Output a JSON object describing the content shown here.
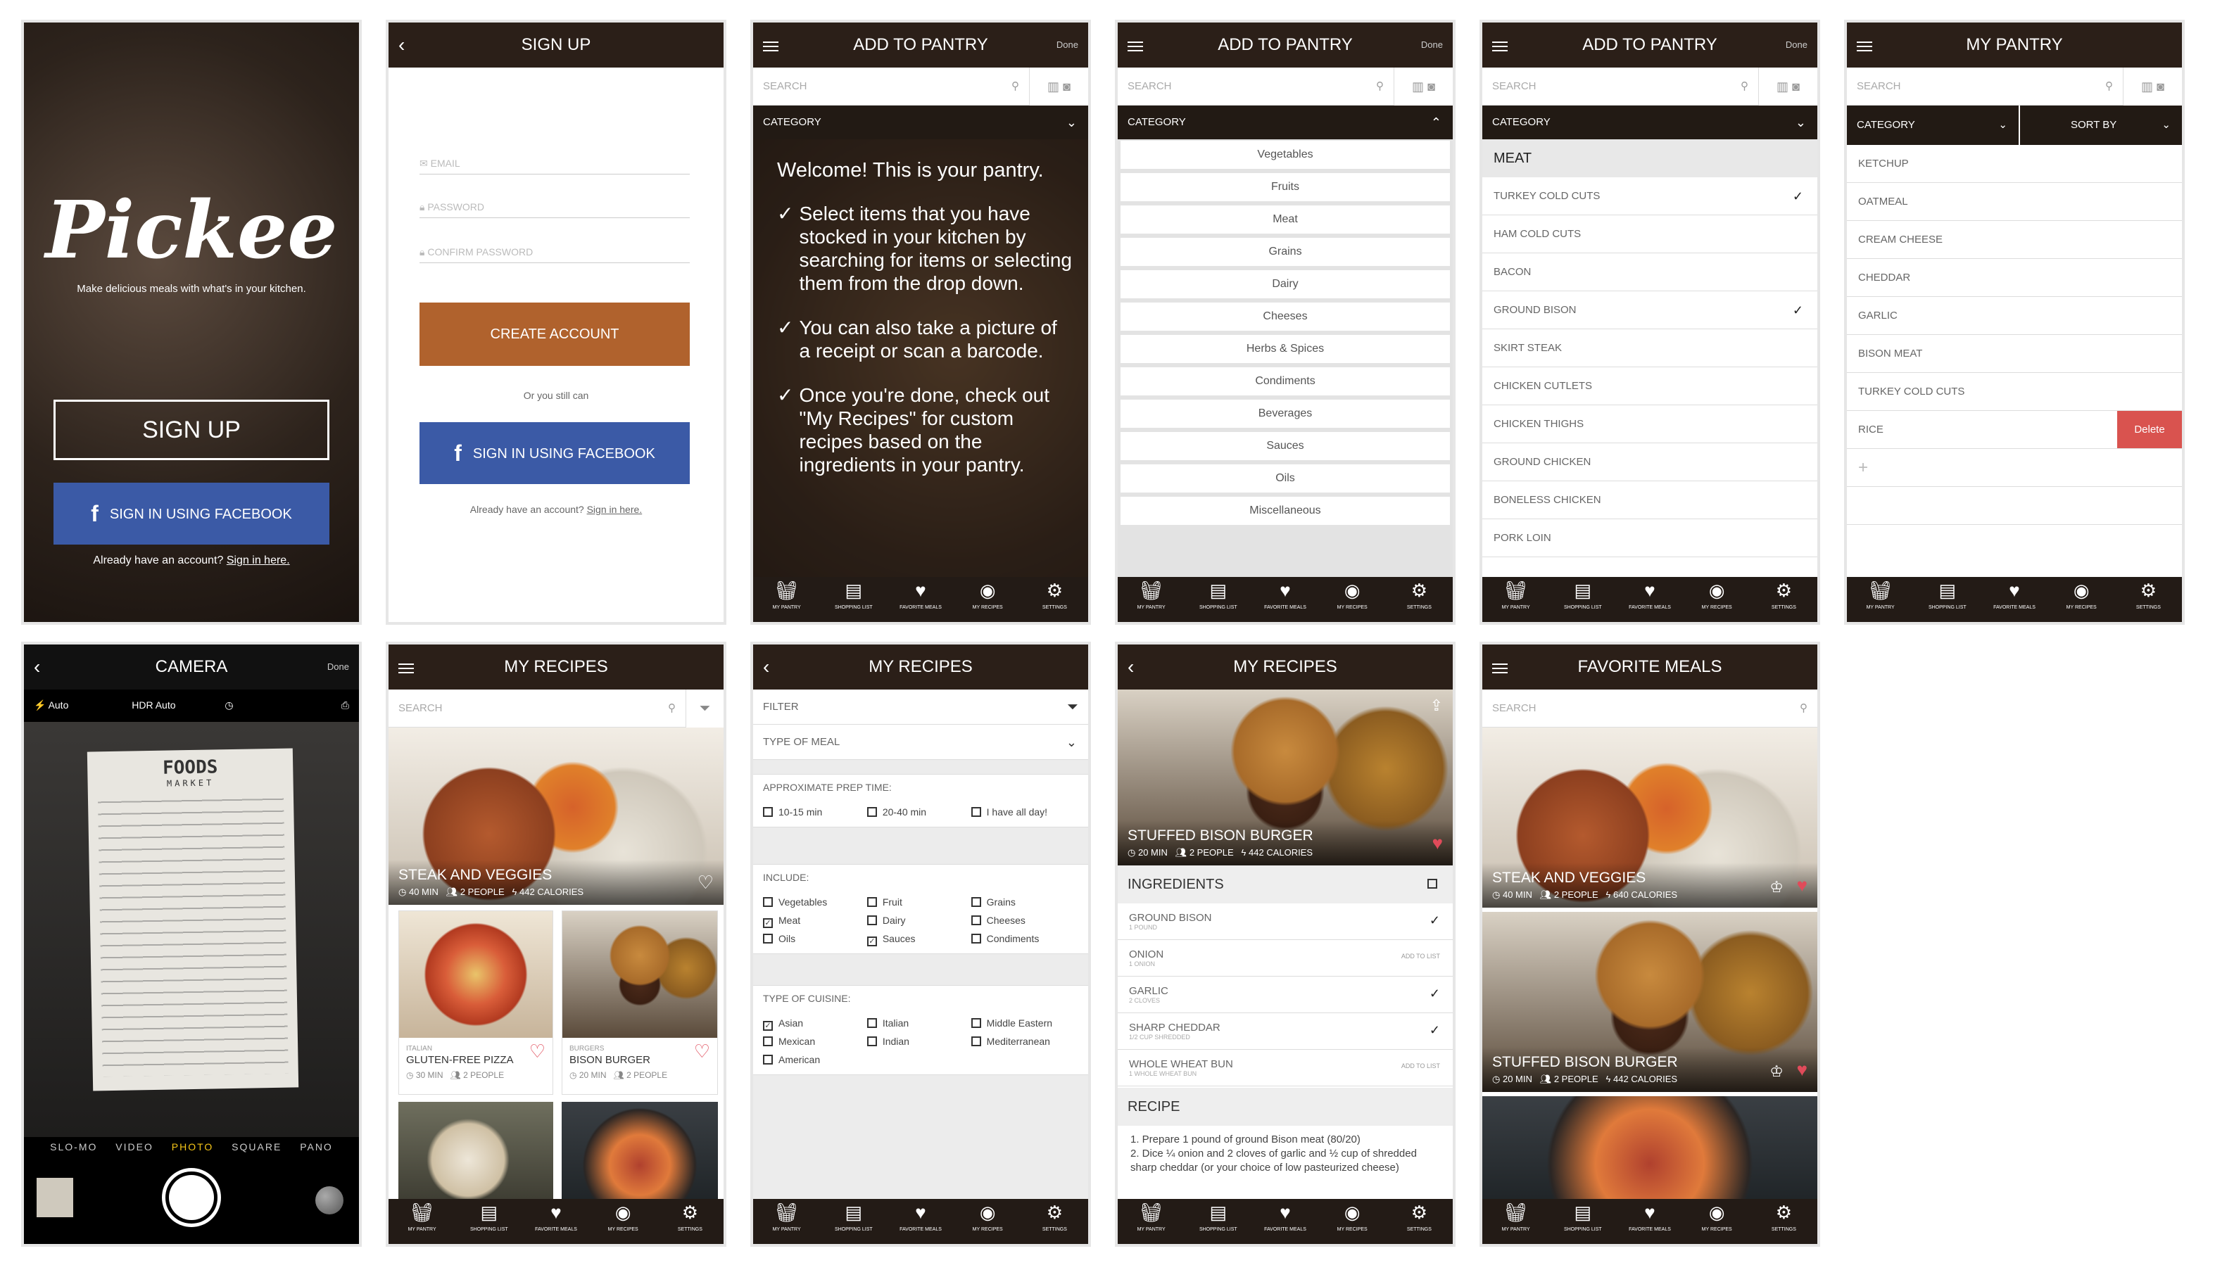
{
  "tabs": [
    {
      "icon": "basket-icon",
      "label": "MY PANTRY"
    },
    {
      "icon": "list-icon",
      "label": "SHOPPING LIST"
    },
    {
      "icon": "heart-icon",
      "label": "FAVORITE MEALS"
    },
    {
      "icon": "plate-icon",
      "label": "MY RECIPES"
    },
    {
      "icon": "gear-icon",
      "label": "SETTINGS"
    }
  ],
  "s1": {
    "logo": "Pickee",
    "tagline": "Make delicious meals with what's in your kitchen.",
    "signup": "SIGN UP",
    "facebook": "SIGN IN USING FACEBOOK",
    "already": "Already have an account?",
    "signin": "Sign in here."
  },
  "s2": {
    "title": "SIGN UP",
    "email": "EMAIL",
    "password": "PASSWORD",
    "confirm": "CONFIRM PASSWORD",
    "create": "CREATE ACCOUNT",
    "or": "Or you still can",
    "facebook": "SIGN IN USING FACEBOOK",
    "already": "Already have an account?",
    "signin": "Sign in here."
  },
  "s3": {
    "title": "ADD TO PANTRY",
    "done": "Done",
    "search": "SEARCH",
    "category": "CATEGORY",
    "welcome": "Welcome! This is your pantry.",
    "tips": [
      "Select items that you have stocked in your kitchen by searching for items or selecting them from the drop down.",
      "You can also take a picture of a receipt or scan a barcode.",
      "Once you're done, check out \"My Recipes\" for custom recipes based on the ingredients in your pantry."
    ]
  },
  "s4": {
    "title": "ADD TO PANTRY",
    "done": "Done",
    "search": "SEARCH",
    "category": "CATEGORY",
    "items": [
      "Vegetables",
      "Fruits",
      "Meat",
      "Grains",
      "Dairy",
      "Cheeses",
      "Herbs & Spices",
      "Condiments",
      "Beverages",
      "Sauces",
      "Oils",
      "Miscellaneous"
    ]
  },
  "s5": {
    "title": "ADD TO PANTRY",
    "done": "Done",
    "search": "SEARCH",
    "category": "CATEGORY",
    "section": "MEAT",
    "items": [
      {
        "name": "TURKEY COLD CUTS",
        "checked": "✓"
      },
      {
        "name": "HAM COLD CUTS",
        "checked": ""
      },
      {
        "name": "BACON",
        "checked": ""
      },
      {
        "name": "GROUND BISON",
        "checked": "✓"
      },
      {
        "name": "SKIRT STEAK",
        "checked": ""
      },
      {
        "name": "CHICKEN CUTLETS",
        "checked": ""
      },
      {
        "name": "CHICKEN THIGHS",
        "checked": ""
      },
      {
        "name": "GROUND CHICKEN",
        "checked": ""
      },
      {
        "name": "BONELESS CHICKEN",
        "checked": ""
      },
      {
        "name": "PORK LOIN",
        "checked": ""
      }
    ]
  },
  "s6": {
    "title": "MY PANTRY",
    "search": "SEARCH",
    "category": "CATEGORY",
    "sortby": "SORT BY",
    "items": [
      "KETCHUP",
      "OATMEAL",
      "CREAM CHEESE",
      "CHEDDAR",
      "GARLIC",
      "BISON MEAT",
      "TURKEY COLD CUTS",
      "RICE"
    ],
    "delete": "Delete",
    "add": "+"
  },
  "s7": {
    "title": "CAMERA",
    "done": "Done",
    "flash": "Auto",
    "hdr": "HDR Auto",
    "modes": [
      "SLO-MO",
      "VIDEO",
      "PHOTO",
      "SQUARE",
      "PANO"
    ],
    "receipt_title": "FOODS",
    "receipt_sub": "MARKET"
  },
  "s8": {
    "title": "MY RECIPES",
    "search": "SEARCH",
    "hero": {
      "name": "STEAK AND VEGGIES",
      "time": "40 MIN",
      "people": "2 PEOPLE",
      "cal": "442 CALORIES"
    },
    "cards": [
      {
        "cat": "ITALIAN",
        "name": "GLUTEN-FREE PIZZA",
        "time": "30 MIN",
        "people": "2 PEOPLE"
      },
      {
        "cat": "BURGERS",
        "name": "BISON BURGER",
        "time": "20 MIN",
        "people": "2 PEOPLE"
      }
    ]
  },
  "s9": {
    "title": "MY RECIPES",
    "filter": "FILTER",
    "meal": "TYPE OF MEAL",
    "prep_h": "APPROXIMATE PREP TIME:",
    "prep": [
      {
        "l": "10-15 min",
        "c": ""
      },
      {
        "l": "20-40 min",
        "c": ""
      },
      {
        "l": "I have all day!",
        "c": ""
      }
    ],
    "inc_h": "INCLUDE:",
    "inc": [
      {
        "l": "Vegetables",
        "c": ""
      },
      {
        "l": "Fruit",
        "c": ""
      },
      {
        "l": "Grains",
        "c": ""
      },
      {
        "l": "Meat",
        "c": "✓"
      },
      {
        "l": "Dairy",
        "c": ""
      },
      {
        "l": "Cheeses",
        "c": ""
      },
      {
        "l": "Oils",
        "c": ""
      },
      {
        "l": "Sauces",
        "c": "✓"
      },
      {
        "l": "Condiments",
        "c": ""
      }
    ],
    "cui_h": "TYPE OF CUISINE:",
    "cui": [
      {
        "l": "Asian",
        "c": "✓"
      },
      {
        "l": "Italian",
        "c": ""
      },
      {
        "l": "Middle Eastern",
        "c": ""
      },
      {
        "l": "Mexican",
        "c": ""
      },
      {
        "l": "Indian",
        "c": ""
      },
      {
        "l": "Mediterranean",
        "c": ""
      },
      {
        "l": "American",
        "c": ""
      }
    ]
  },
  "s10": {
    "title": "MY RECIPES",
    "hero": {
      "name": "STUFFED BISON BURGER",
      "time": "20 MIN",
      "people": "2 PEOPLE",
      "cal": "442 CALORIES"
    },
    "ing_h": "INGREDIENTS",
    "ings": [
      {
        "name": "GROUND BISON",
        "qty": "1 POUND",
        "state": "✓"
      },
      {
        "name": "ONION",
        "qty": "1 ONION",
        "state": "ADD TO LIST"
      },
      {
        "name": "GARLIC",
        "qty": "2 CLOVES",
        "state": "✓"
      },
      {
        "name": "SHARP CHEDDAR",
        "qty": "1/2 CUP SHREDDED",
        "state": "✓"
      },
      {
        "name": "WHOLE WHEAT BUN",
        "qty": "1 WHOLE WHEAT BUN",
        "state": "ADD TO LIST"
      }
    ],
    "rec_h": "RECIPE",
    "steps": [
      "1.  Prepare 1 pound of ground Bison meat (80/20)",
      "2.  Dice ¼ onion and 2 cloves of garlic and ½ cup of shredded sharp cheddar (or your choice of low pasteurized cheese)"
    ]
  },
  "s11": {
    "title": "FAVORITE MEALS",
    "search": "SEARCH",
    "cards": [
      {
        "name": "STEAK AND VEGGIES",
        "time": "40 MIN",
        "people": "2 PEOPLE",
        "cal": "640 CALORIES"
      },
      {
        "name": "STUFFED BISON BURGER",
        "time": "20 MIN",
        "people": "2 PEOPLE",
        "cal": "442 CALORIES"
      }
    ]
  }
}
